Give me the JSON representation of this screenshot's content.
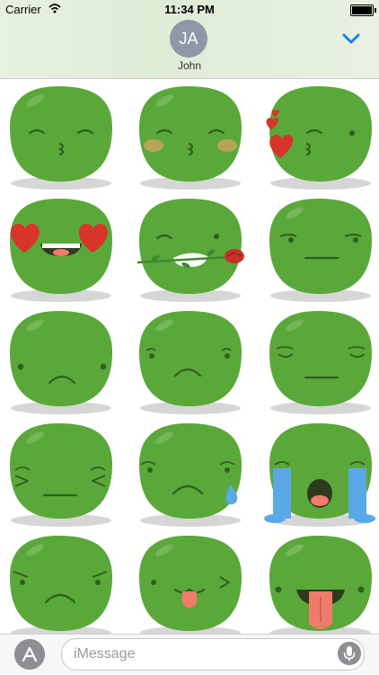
{
  "status_bar": {
    "carrier": "Carrier",
    "time": "11:34 PM"
  },
  "header": {
    "avatar_initials": "JA",
    "contact_name": "John"
  },
  "input": {
    "placeholder": "iMessage"
  },
  "stickers": [
    {
      "name": "kiss-blush-eyes"
    },
    {
      "name": "kiss-rosy-cheeks"
    },
    {
      "name": "kiss-hearts"
    },
    {
      "name": "heart-eyes"
    },
    {
      "name": "rose-in-mouth"
    },
    {
      "name": "smirk"
    },
    {
      "name": "sad"
    },
    {
      "name": "frown"
    },
    {
      "name": "disappointed"
    },
    {
      "name": "squint-upset"
    },
    {
      "name": "sad-sweat"
    },
    {
      "name": "crying"
    },
    {
      "name": "annoyed"
    },
    {
      "name": "tongue-out-silly"
    },
    {
      "name": "tongue-out-happy"
    }
  ],
  "colors": {
    "body": "#5aa83a",
    "body_dark": "#4a9330",
    "shadow": "#d6d6d6",
    "heart": "#d8342a",
    "tear": "#5aa9e6"
  },
  "icons": [
    "wifi-icon",
    "battery-icon",
    "chevron-down-icon",
    "app-store-icon",
    "microphone-icon"
  ]
}
